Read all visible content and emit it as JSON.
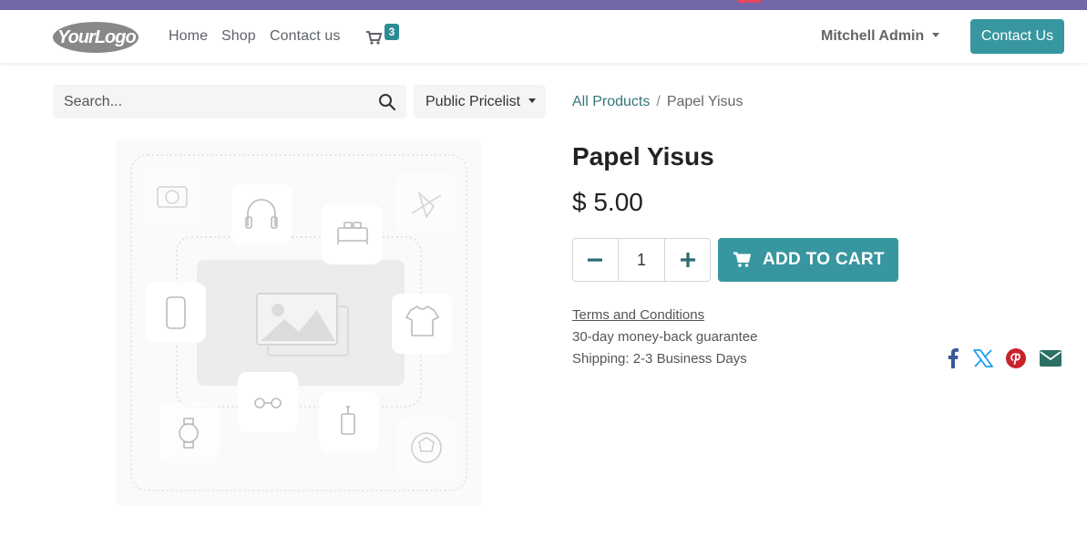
{
  "navbar": {
    "logo_text": "YourLogo",
    "links": [
      "Home",
      "Shop",
      "Contact us"
    ],
    "cart_count": "3",
    "user_name": "Mitchell Admin",
    "contact_button": "Contact Us"
  },
  "search": {
    "placeholder": "Search..."
  },
  "pricelist": {
    "label": "Public Pricelist"
  },
  "breadcrumb": {
    "parent": "All Products",
    "separator": "/",
    "current": "Papel Yisus"
  },
  "product": {
    "name": "Papel Yisus",
    "price": "$ 5.00",
    "quantity": "1",
    "add_to_cart": "ADD TO CART",
    "terms": "Terms and Conditions",
    "guarantee": "30-day money-back guarantee",
    "shipping": "Shipping: 2-3 Business Days"
  },
  "share": [
    "facebook-icon",
    "x-icon",
    "pinterest-icon",
    "email-icon"
  ],
  "colors": {
    "accent": "#37969f",
    "topbar": "#7367a8",
    "facebook": "#3b5998",
    "x": "#1da1f2",
    "pinterest": "#c8232c",
    "email": "#2c6f63"
  }
}
